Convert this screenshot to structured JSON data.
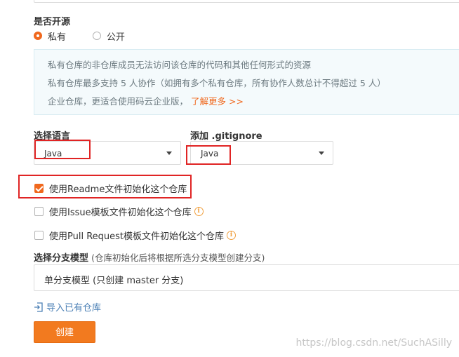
{
  "open_source": {
    "label": "是否开源",
    "options": [
      {
        "label": "私有",
        "selected": true
      },
      {
        "label": "公开",
        "selected": false
      }
    ]
  },
  "info": {
    "lines": [
      "私有仓库的非仓库成员无法访问该仓库的代码和其他任何形式的资源",
      "私有仓库最多支持 5 人协作（如拥有多个私有仓库，所有协作人数总计不得超过 5 人）",
      "企业仓库，更适合使用码云企业版，"
    ],
    "more_link": "了解更多 >>"
  },
  "language": {
    "label": "选择语言",
    "value": "Java"
  },
  "gitignore": {
    "label": "添加 .gitignore",
    "value": "Java"
  },
  "checkboxes": [
    {
      "label": "使用Readme文件初始化这个仓库",
      "checked": true
    },
    {
      "label": "使用Issue模板文件初始化这个仓库",
      "checked": false
    },
    {
      "label": "使用Pull Request模板文件初始化这个仓库",
      "checked": false
    }
  ],
  "branch_model": {
    "label": "选择分支模型",
    "hint": "(仓库初始化后将根据所选分支模型创建分支)",
    "value": "单分支模型 (只创建 master 分支)"
  },
  "import_link": "导入已有仓库",
  "create_button": "创建",
  "watermark": "https://blog.csdn.net/SuchASilly",
  "colors": {
    "accent": "#f0681d",
    "annotation": "#e02424",
    "link": "#4a7fb5"
  }
}
